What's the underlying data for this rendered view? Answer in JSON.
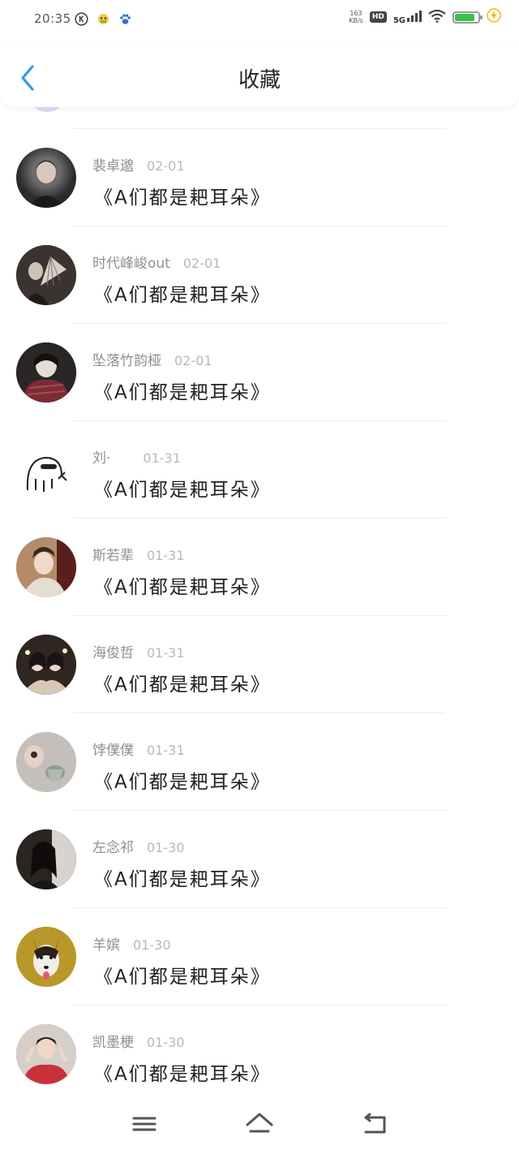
{
  "status_bar": {
    "time": "20:35",
    "net_speed_value": "163",
    "net_speed_unit": "KB/s",
    "hd_label": "HD",
    "network_label": "5G",
    "battery_level": 0.85,
    "left_icons": [
      "k-circle-icon",
      "app-face-icon",
      "paw-icon"
    ],
    "right_icons": [
      "signal-bars-icon",
      "wifi-icon",
      "battery-icon",
      "charging-bolt-icon"
    ]
  },
  "header": {
    "title": "收藏",
    "back_icon": "chevron-left-icon",
    "accent": "#2f9be8"
  },
  "items": [
    {
      "name": "裴卓邈",
      "date": "02-01",
      "title": "《A们都是耙耳朵》",
      "avatar_color": "#2b2b2b"
    },
    {
      "name": "时代峰峻out",
      "date": "02-01",
      "title": "《A们都是耙耳朵》",
      "avatar_color": "#4a4340"
    },
    {
      "name": "坠落竹韵桠",
      "date": "02-01",
      "title": "《A们都是耙耳朵》",
      "avatar_color": "#6e3a3e"
    },
    {
      "name": "刘·",
      "date": "01-31",
      "title": "《A们都是耙耳朵》",
      "avatar_color": "#ffffff"
    },
    {
      "name": "斯若辈",
      "date": "01-31",
      "title": "《A们都是耙耳朵》",
      "avatar_color": "#c9a58a"
    },
    {
      "name": "海俊哲",
      "date": "01-31",
      "title": "《A们都是耙耳朵》",
      "avatar_color": "#3b2e2a"
    },
    {
      "name": "饽僕僕",
      "date": "01-31",
      "title": "《A们都是耙耳朵》",
      "avatar_color": "#b5b0ab"
    },
    {
      "name": "左念祁",
      "date": "01-30",
      "title": "《A们都是耙耳朵》",
      "avatar_color": "#2f2a28"
    },
    {
      "name": "羊嫔",
      "date": "01-30",
      "title": "《A们都是耙耳朵》",
      "avatar_color": "#c7a431"
    },
    {
      "name": "凯墨梗",
      "date": "01-30",
      "title": "《A们都是耙耳朵》",
      "avatar_color": "#c23a3f"
    }
  ],
  "nav_bar": {
    "menu_icon": "menu-lines-icon",
    "home_icon": "home-icon",
    "back_icon": "back-arrow-icon"
  }
}
